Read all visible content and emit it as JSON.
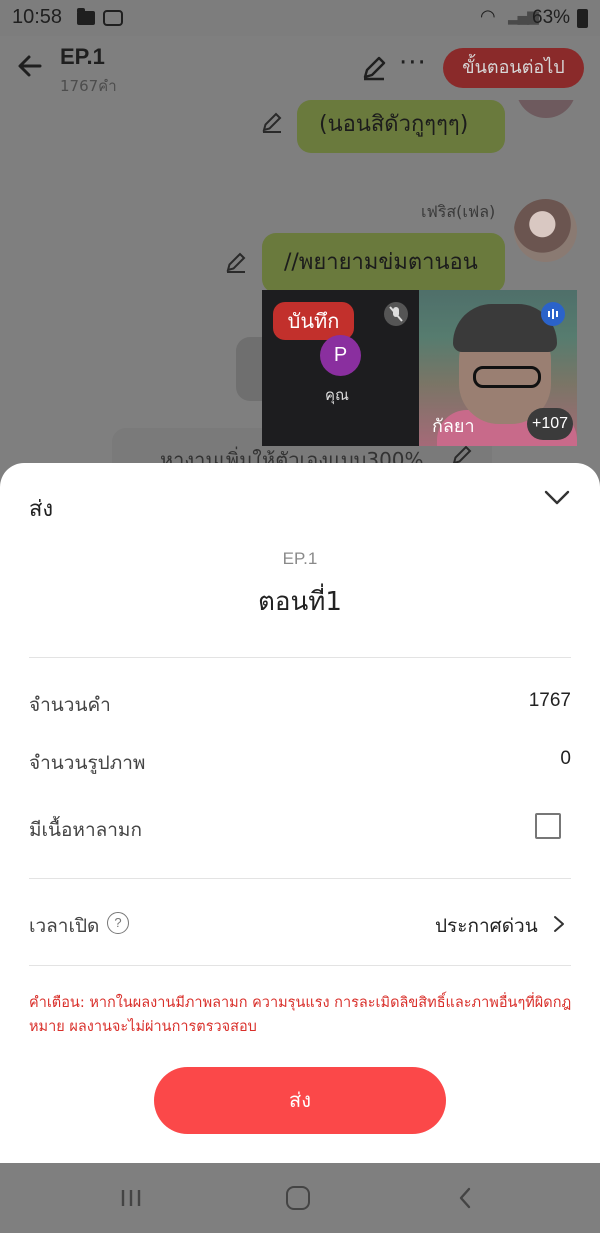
{
  "status_bar": {
    "time": "10:58",
    "battery": "63%"
  },
  "header": {
    "title": "EP.1",
    "word_count": "1767คำ",
    "next_button": "ขั้นตอนต่อไป"
  },
  "chat": {
    "messages": [
      {
        "text": "(นอนสิดัวกูๆๆๆ)"
      },
      {
        "sender": "เฟริส(เฟล)",
        "text": "//พยายามข่มตานอน"
      }
    ],
    "partial_text": "หางานเพิ่มให้ตัวเองแบบ300%"
  },
  "call": {
    "record_label": "บันทึก",
    "self_initial": "P",
    "self_label": "คุณ",
    "caller_name": "กัลยา",
    "more_count": "+107"
  },
  "sheet": {
    "title": "ส่ง",
    "ep_label": "EP.1",
    "ep_name": "ตอนที่1",
    "rows": {
      "words_label": "จำนวนคำ",
      "words_value": "1767",
      "images_label": "จำนวนรูปภาพ",
      "images_value": "0",
      "mature_label": "มีเนื้อหาลามก",
      "time_label": "เวลาเปิด",
      "time_value": "ประกาศด่วน"
    },
    "warning": "คำเตือน: หากในผลงานมีภาพลามก ความรุนแรง การละเมิดลิขสิทธิ์และภาพอื่นๆที่ผิดกฎหมาย ผลงานจะไม่ผ่านการตรวจสอบ",
    "send_button": "ส่ง"
  },
  "colors": {
    "accent": "#fb4849",
    "warning": "#d92f2a",
    "bubble": "#6a7a3d"
  }
}
